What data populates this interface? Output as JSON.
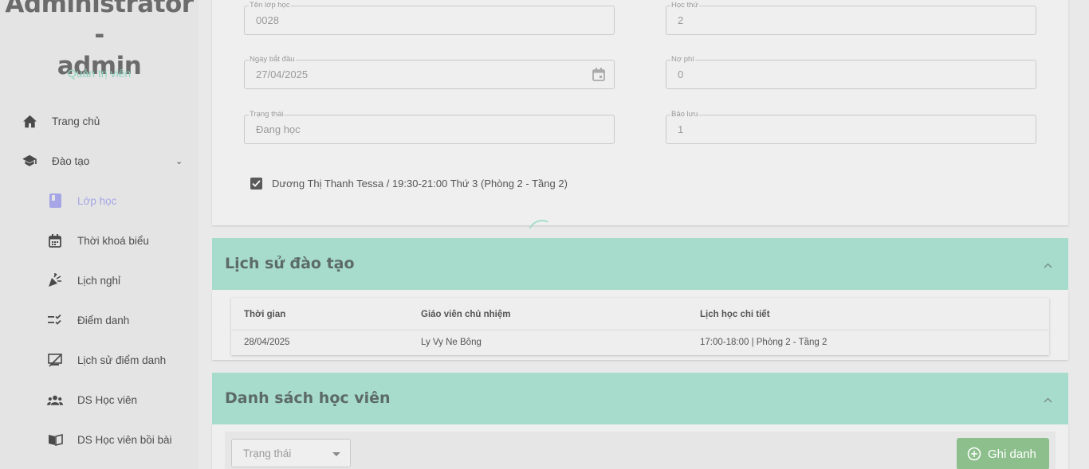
{
  "user": {
    "name_lines": [
      "Administrator -",
      "admin"
    ],
    "role": "Quản trị viên"
  },
  "sidebar": {
    "items": [
      {
        "label": "Trang chủ",
        "icon": "home-icon"
      },
      {
        "label": "Đào tạo",
        "icon": "school-icon",
        "expanded": true
      },
      {
        "label": "Lớp học",
        "icon": "class-book-icon",
        "active": true
      },
      {
        "label": "Thời khoá biểu",
        "icon": "calendar-icon"
      },
      {
        "label": "Lịch nghỉ",
        "icon": "celebration-icon"
      },
      {
        "label": "Điểm danh",
        "icon": "checklist-icon"
      },
      {
        "label": "Lịch sử điểm danh",
        "icon": "history-board-icon"
      },
      {
        "label": "DS Học viên",
        "icon": "group-icon"
      },
      {
        "label": "DS Học viên bồi bài",
        "icon": "book-icon"
      }
    ]
  },
  "class_form": {
    "class_name": {
      "label": "Tên lớp học",
      "value": "0028"
    },
    "session_no": {
      "label": "Học thứ",
      "value": "2"
    },
    "start_date": {
      "label": "Ngày bắt đầu",
      "value": "27/04/2025"
    },
    "debt": {
      "label": "Nợ phí",
      "value": "0"
    },
    "status": {
      "label": "Trạng thái",
      "value": "Đang học"
    },
    "reserve": {
      "label": "Bảo lưu",
      "value": "1"
    },
    "schedule_checkbox": {
      "checked": true,
      "label": "Dương Thị Thanh Tessa / 19:30-21:00 Thứ 3 (Phòng 2 - Tầng 2)"
    }
  },
  "training_history": {
    "title": "Lịch sử đào tạo",
    "columns": [
      "Thời gian",
      "Giáo viên chủ nhiệm",
      "Lịch học chi tiết"
    ],
    "rows": [
      [
        "28/04/2025",
        "Ly Vy Ne Bông",
        "17:00-18:00 | Phòng 2 - Tầng 2"
      ]
    ]
  },
  "students": {
    "title": "Danh sách học viên",
    "status_filter": {
      "placeholder": "Trạng thái"
    },
    "enroll_button": "Ghi danh"
  },
  "colors": {
    "section_header": "#a7dccd",
    "accent_role": "#8fd3bf",
    "enroll_button": "#8cbf8c",
    "active_nav": "#a6a6e6"
  }
}
